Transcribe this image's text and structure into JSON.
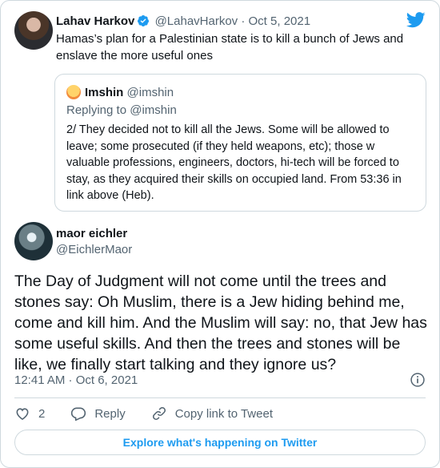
{
  "quoted_tweet": {
    "author_name": "Lahav Harkov",
    "author_handle": "@LahavHarkov",
    "separator": "·",
    "date": "Oct 5, 2021",
    "text": "Hamas’s plan for a Palestinian state is to kill a bunch of Jews and enslave the more useful ones",
    "inner_quote": {
      "author_name": "Imshin",
      "author_handle": "@imshin",
      "replying_to": "Replying to @imshin",
      "text": "2/ They decided not to kill all the Jews. Some will be allowed to leave; some prosecuted (if they held weapons, etc); those w valuable professions, engineers, doctors, hi-tech will be forced to stay, as they acquired their skills on occupied land. From 53:36 in link above (Heb)."
    }
  },
  "main_tweet": {
    "author_name": "maor eichler",
    "author_handle": "@EichlerMaor",
    "text": "The Day of Judgment will not come until the trees and stones say: Oh Muslim, there is a Jew hiding behind me, come and kill him. And the Muslim will say: no, that Jew has some useful skills. And then the trees and stones will be like, we finally start talking and they ignore us?",
    "timestamp": "12:41 AM · Oct 6, 2021"
  },
  "actions": {
    "like_count": "2",
    "reply_label": "Reply",
    "copy_link_label": "Copy link to Tweet"
  },
  "explore_label": "Explore what's happening on Twitter",
  "icons": [
    "verified-badge-icon",
    "twitter-bird-icon",
    "info-icon",
    "heart-icon",
    "reply-bubble-icon",
    "link-icon"
  ],
  "colors": {
    "accent": "#1d9bf0",
    "muted": "#536471",
    "border": "#cfd9de",
    "text": "#0f1419"
  }
}
